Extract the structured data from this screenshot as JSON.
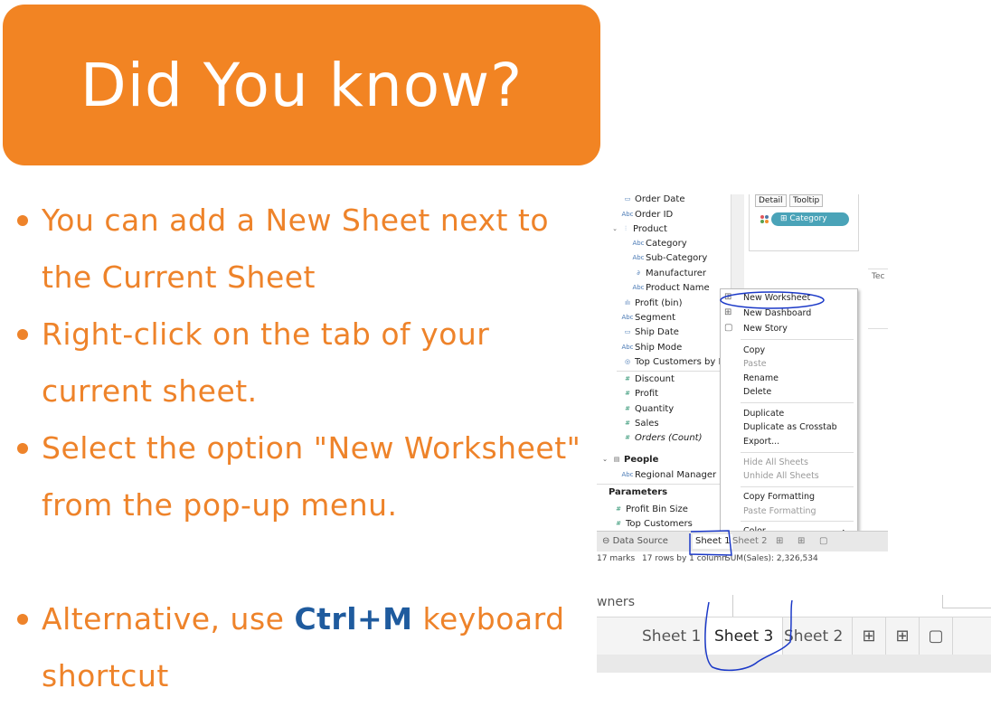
{
  "banner": {
    "title": "Did You know?"
  },
  "bullets": [
    {
      "text": "You can add a New Sheet next to the Current Sheet"
    },
    {
      "text": "Right-click on the tab of your current sheet."
    },
    {
      "text": "Select the option \"New Worksheet\" from the pop-up menu."
    },
    {
      "prefix": "Alternative, use ",
      "key": "Ctrl+M",
      "suffix": " keyboard shortcut"
    }
  ],
  "colors": {
    "banner": "#f28423",
    "bullet_text": "#ee832a",
    "shortcut": "#1f5b9e",
    "annotation": "#1b39c8"
  },
  "tableau": {
    "fields": [
      {
        "icon": "calendar-icon",
        "label": "Order Date"
      },
      {
        "icon": "abc-icon",
        "label": "Order ID"
      },
      {
        "icon": "hierarchy-icon",
        "label": "Product"
      },
      {
        "icon": "abc-icon",
        "label": "Category"
      },
      {
        "icon": "abc-icon",
        "label": "Sub-Category"
      },
      {
        "icon": "link-icon",
        "label": "Manufacturer"
      },
      {
        "icon": "abc-icon",
        "label": "Product Name"
      },
      {
        "icon": "bin-icon",
        "label": "Profit (bin)"
      },
      {
        "icon": "abc-icon",
        "label": "Segment"
      },
      {
        "icon": "calendar-icon",
        "label": "Ship Date"
      },
      {
        "icon": "abc-icon",
        "label": "Ship Mode"
      },
      {
        "icon": "set-icon",
        "label": "Top Customers by P..."
      },
      {
        "icon": "measure-icon",
        "label": "Discount"
      },
      {
        "icon": "measure-icon",
        "label": "Profit"
      },
      {
        "icon": "measure-icon",
        "label": "Quantity"
      },
      {
        "icon": "measure-icon",
        "label": "Sales"
      },
      {
        "icon": "measure-icon",
        "label": "Orders (Count)"
      }
    ],
    "people_group": "People",
    "people_fields": [
      {
        "icon": "abc-icon",
        "label": "Regional Manager"
      }
    ],
    "parameters_header": "Parameters",
    "parameters": [
      {
        "icon": "param-icon",
        "label": "Profit Bin Size"
      },
      {
        "icon": "param-icon",
        "label": "Top Customers"
      }
    ],
    "marks_card": {
      "detail": "Detail",
      "tooltip": "Tooltip",
      "pill": "Category",
      "side_text": "Tec"
    },
    "context_menu": [
      {
        "label": "New Worksheet",
        "icon": "new-worksheet-icon",
        "disabled": false
      },
      {
        "label": "New Dashboard",
        "icon": "new-dashboard-icon",
        "disabled": false
      },
      {
        "label": "New Story",
        "icon": "new-story-icon",
        "disabled": false
      },
      {
        "label": "Copy",
        "disabled": false
      },
      {
        "label": "Paste",
        "disabled": true
      },
      {
        "label": "Rename",
        "disabled": false
      },
      {
        "label": "Delete",
        "disabled": false
      },
      {
        "label": "Duplicate",
        "disabled": false
      },
      {
        "label": "Duplicate as Crosstab",
        "disabled": false
      },
      {
        "label": "Export...",
        "disabled": false
      },
      {
        "label": "Hide All Sheets",
        "disabled": true
      },
      {
        "label": "Unhide All Sheets",
        "disabled": true
      },
      {
        "label": "Copy Formatting",
        "disabled": false
      },
      {
        "label": "Paste Formatting",
        "disabled": true
      },
      {
        "label": "Color",
        "disabled": false,
        "submenu": true
      }
    ],
    "tabs": {
      "data_source": "Data Source",
      "sheet1": "Sheet 1",
      "sheet2": "Sheet 2"
    },
    "status": {
      "marks": "17 marks",
      "rows": "17 rows by 1 column",
      "sum": "SUM(Sales): 2,326,534"
    }
  },
  "tabstrip": {
    "partial_text": "wners",
    "tabs": [
      "Sheet 1",
      "Sheet 3",
      "Sheet 2"
    ],
    "active_tab": "Sheet 3",
    "buttons": [
      "new-worksheet-icon",
      "new-dashboard-icon",
      "new-story-icon"
    ]
  }
}
